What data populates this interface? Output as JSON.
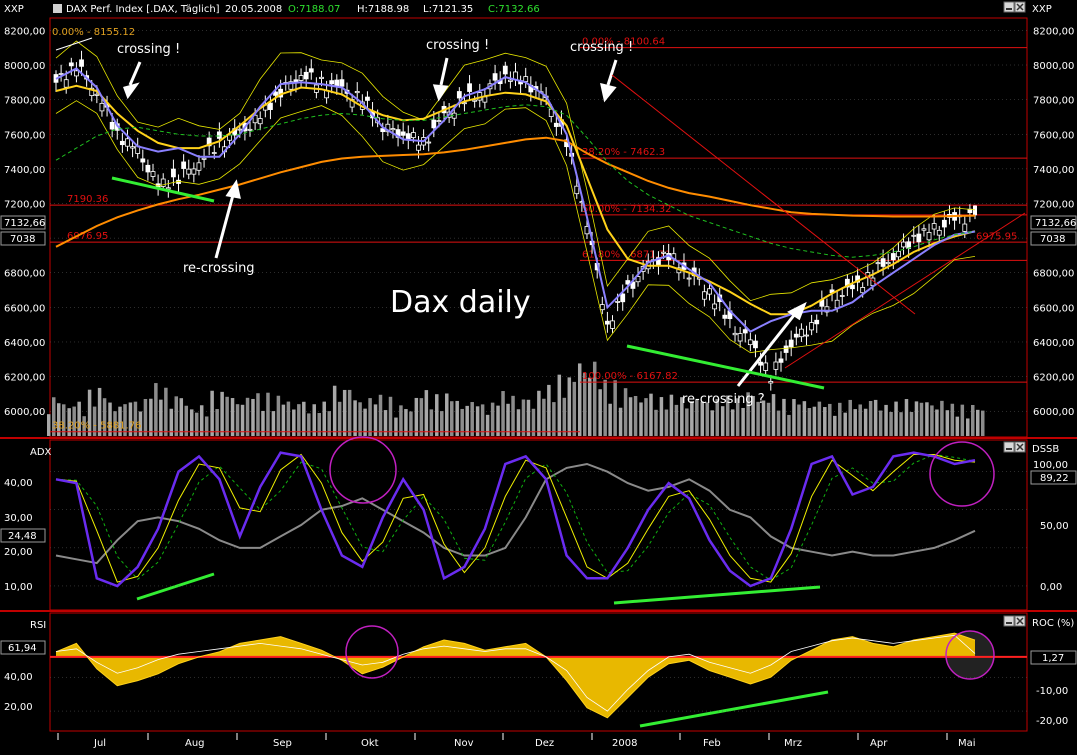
{
  "colors": {
    "background": "#000000",
    "frame": "#c00000",
    "grid": "#5a5a5a",
    "axis_text": "#ffffff",
    "price_bar": "#ffffff",
    "volume": "#a8a8a8",
    "ma_long": "#ff8c00",
    "ma_mid": "#ffd21a",
    "ma_short": "#8a80ff",
    "ma_dashed": "#1fc01f",
    "bollinger": "#e6e600",
    "fib": "#e01010",
    "divergence": "#33ee33",
    "annotation_arrow": "#ffffff",
    "highlight_circle": "#c020c0",
    "adx_line": "#8a8a8a",
    "stoch_fast": "#6a2cf0",
    "stoch_slow": "#f0f000",
    "stoch_signal": "#10b010",
    "rsi_fill": "#e8b800",
    "rsi_line": "#ffd21a",
    "roc_line": "#ffffff",
    "ref_line": "#ff2020",
    "label_box_bg": "#000000",
    "label_box_border": "#9a9a9a"
  },
  "header": {
    "left_tag": "XXP",
    "right_tag": "XXP",
    "title": "DAX Perf. Index [.DAX, Täglich]",
    "date": "20.05.2008",
    "open": "O:7188.07",
    "high": "H:7188.98",
    "low": "L:7121.35",
    "close": "C:7132.66",
    "icons": [
      "minimize-icon",
      "close-icon"
    ]
  },
  "price_panel": {
    "left_ticks": [
      "8200,00",
      "8000,00",
      "7800,00",
      "7600,00",
      "7400,00",
      "7200,00",
      "7000,00",
      "6800,00",
      "6600,00",
      "6400,00",
      "6200,00",
      "6000,00"
    ],
    "right_ticks": [
      "8200,00",
      "8000,00",
      "7800,00",
      "7600,00",
      "7400,00",
      "7200,00",
      "7000,00",
      "6800,00",
      "6600,00",
      "6400,00",
      "6200,00",
      "6000,00"
    ],
    "left_badges": [
      "7132,66",
      "7038"
    ],
    "right_badges": [
      "7132,66",
      "7038"
    ],
    "title_text": "Dax daily",
    "annotations": [
      "crossing !",
      "crossing !",
      "crossing !",
      "re-crossing",
      "re-crossing ?"
    ],
    "fib_labels_left": [
      "0.00% - 8155.12",
      "7190.36",
      "6976.95",
      "38.20% - 5881.76"
    ],
    "fib_labels_right": [
      "0.00% - 8100.64",
      "38.20% - 7462.3",
      "50.00% - 7134.32",
      "61.80% - 6871.71",
      "100.00% - 6167.82",
      "6975.95"
    ]
  },
  "stoch_panel": {
    "left_title": "ADX",
    "right_title": "DSSB",
    "left_ticks": [
      "40,00",
      "30,00",
      "20,00",
      "10,00"
    ],
    "right_ticks": [
      "100,00",
      "50,00",
      "0,00"
    ],
    "left_badge": "24,48",
    "right_badge": "89,22",
    "icons": [
      "minimize-icon",
      "close-icon"
    ]
  },
  "rsi_panel": {
    "left_title": "RSI",
    "right_title": "ROC (%)",
    "left_ticks": [
      "40,00",
      "20,00"
    ],
    "right_ticks": [
      "-10,00",
      "-20,00"
    ],
    "left_badge": "61,94",
    "right_badge": "1,27",
    "icons": [
      "minimize-icon",
      "close-icon"
    ]
  },
  "x_axis": {
    "labels": [
      "Jul",
      "Aug",
      "Sep",
      "Okt",
      "Nov",
      "Dez",
      "2008",
      "Feb",
      "Mrz",
      "Apr",
      "Mai"
    ]
  },
  "chart_data": [
    {
      "type": "candlestick",
      "title": "DAX Perf. Index [.DAX, Täglich]",
      "subtitle": "Dax daily",
      "x": [
        "Jul",
        "Aug",
        "Sep",
        "Okt",
        "Nov",
        "Dez",
        "2008",
        "Feb",
        "Mrz",
        "Apr",
        "Mai"
      ],
      "ylim": [
        5880,
        8260
      ],
      "y_ticks": [
        6000,
        6200,
        6400,
        6600,
        6800,
        7000,
        7200,
        7400,
        7600,
        7800,
        8000,
        8200
      ],
      "grid": false,
      "series": [
        {
          "name": "close",
          "values": [
            7900,
            8000,
            7850,
            7600,
            7500,
            7300,
            7350,
            7450,
            7550,
            7600,
            7700,
            7850,
            7950,
            7900,
            7850,
            7800,
            7650,
            7600,
            7550,
            7700,
            7800,
            7850,
            7950,
            7900,
            7800,
            7550,
            7100,
            6500,
            6700,
            6850,
            6900,
            6800,
            6700,
            6500,
            6400,
            6200,
            6400,
            6500,
            6650,
            6700,
            6800,
            6900,
            7000,
            7050,
            7100,
            7132.66
          ]
        },
        {
          "name": "ma_long",
          "values": [
            6950,
            7010,
            7070,
            7120,
            7160,
            7195,
            7225,
            7250,
            7280,
            7310,
            7345,
            7380,
            7410,
            7440,
            7460,
            7470,
            7475,
            7480,
            7485,
            7495,
            7510,
            7530,
            7550,
            7570,
            7580,
            7560,
            7490,
            7430,
            7380,
            7330,
            7290,
            7260,
            7240,
            7215,
            7190,
            7170,
            7150,
            7140,
            7135,
            7130,
            7128,
            7125,
            7125,
            7125,
            7128,
            7130
          ]
        },
        {
          "name": "ma_mid",
          "values": [
            7850,
            7880,
            7850,
            7720,
            7620,
            7550,
            7520,
            7520,
            7560,
            7650,
            7750,
            7830,
            7870,
            7860,
            7830,
            7760,
            7710,
            7680,
            7690,
            7740,
            7790,
            7820,
            7840,
            7830,
            7790,
            7650,
            7350,
            7050,
            6880,
            6840,
            6840,
            6800,
            6750,
            6690,
            6620,
            6560,
            6560,
            6610,
            6680,
            6740,
            6790,
            6850,
            6920,
            6970,
            7010,
            7040
          ]
        },
        {
          "name": "ma_short",
          "values": [
            7920,
            7980,
            7870,
            7650,
            7530,
            7500,
            7520,
            7470,
            7470,
            7600,
            7760,
            7890,
            7900,
            7890,
            7870,
            7780,
            7640,
            7570,
            7560,
            7680,
            7820,
            7860,
            7930,
            7900,
            7820,
            7600,
            7120,
            6600,
            6720,
            6860,
            6900,
            6820,
            6740,
            6580,
            6460,
            6520,
            6560,
            6580,
            6580,
            6630,
            6720,
            6800,
            6880,
            6960,
            7020,
            7038
          ]
        },
        {
          "name": "ma_dashed",
          "values": [
            7450,
            7520,
            7590,
            7630,
            7640,
            7620,
            7600,
            7590,
            7590,
            7600,
            7630,
            7660,
            7690,
            7710,
            7720,
            7710,
            7690,
            7680,
            7680,
            7700,
            7720,
            7740,
            7760,
            7770,
            7760,
            7710,
            7580,
            7440,
            7330,
            7250,
            7190,
            7130,
            7090,
            7050,
            7010,
            6970,
            6940,
            6920,
            6900,
            6890,
            6900,
            6920,
            6950,
            6990,
            7020,
            7040
          ]
        }
      ],
      "volume": [
        45,
        40,
        55,
        38,
        42,
        60,
        48,
        35,
        52,
        44,
        50,
        46,
        41,
        39,
        57,
        43,
        47,
        36,
        53,
        49,
        40,
        38,
        51,
        45,
        58,
        70,
        85,
        65,
        55,
        50,
        47,
        44,
        42,
        46,
        52,
        48,
        43,
        40,
        38,
        41,
        44,
        39,
        42,
        40,
        37,
        36
      ],
      "reference_levels": [
        8155.12,
        8100.64,
        7462.3,
        7190.36,
        7134.32,
        6976.95,
        6975.95,
        6871.71,
        6167.82,
        5881.76
      ]
    },
    {
      "type": "line",
      "title": "ADX / DSSB",
      "x": [
        "Jul",
        "Aug",
        "Sep",
        "Okt",
        "Nov",
        "Dez",
        "2008",
        "Feb",
        "Mrz",
        "Apr",
        "Mai"
      ],
      "ylim": [
        5,
        47
      ],
      "y_ticks": [
        10,
        20,
        30,
        40
      ],
      "series": [
        {
          "name": "ADX",
          "values": [
            18,
            17,
            16,
            22,
            27,
            28,
            27,
            25,
            22,
            20,
            20,
            23,
            26,
            30,
            31,
            33,
            30,
            27,
            24,
            20,
            18,
            18,
            20,
            28,
            38,
            41,
            42,
            40,
            37,
            35,
            36,
            38,
            35,
            30,
            28,
            23,
            20,
            19,
            18,
            19,
            18,
            18,
            19,
            20,
            22,
            24.48
          ]
        },
        {
          "name": "DSSB",
          "values": [
            38,
            37,
            12,
            10,
            15,
            25,
            40,
            44,
            38,
            23,
            36,
            45,
            44,
            30,
            18,
            15,
            28,
            38,
            30,
            12,
            15,
            25,
            42,
            44,
            38,
            18,
            12,
            12,
            20,
            30,
            37,
            33,
            22,
            14,
            10,
            12,
            25,
            42,
            44,
            34,
            36,
            44,
            45,
            44,
            42,
            43
          ]
        }
      ]
    },
    {
      "type": "area",
      "title": "RSI / ROC (%)",
      "x": [
        "Jul",
        "Aug",
        "Sep",
        "Okt",
        "Nov",
        "Dez",
        "2008",
        "Feb",
        "Mrz",
        "Apr",
        "Mai"
      ],
      "ylim": [
        10,
        75
      ],
      "y_ticks": [
        20,
        40
      ],
      "series": [
        {
          "name": "RSI",
          "values": [
            55,
            60,
            45,
            35,
            38,
            42,
            48,
            52,
            55,
            60,
            62,
            64,
            60,
            56,
            50,
            42,
            46,
            52,
            58,
            62,
            60,
            56,
            58,
            60,
            52,
            38,
            22,
            16,
            28,
            40,
            48,
            50,
            44,
            40,
            36,
            40,
            50,
            56,
            62,
            64,
            60,
            58,
            62,
            64,
            66,
            61.94
          ]
        },
        {
          "name": "ROC (%)",
          "values": [
            2,
            3,
            -2,
            -6,
            -4,
            -1,
            1,
            2,
            3,
            4,
            5,
            4,
            3,
            1,
            -1,
            -3,
            -2,
            1,
            3,
            4,
            3,
            2,
            3,
            3,
            0,
            -5,
            -15,
            -20,
            -12,
            -5,
            0,
            1,
            -2,
            -4,
            -6,
            -3,
            2,
            4,
            6,
            7,
            6,
            5,
            6,
            7,
            8,
            1.27
          ]
        }
      ]
    }
  ]
}
